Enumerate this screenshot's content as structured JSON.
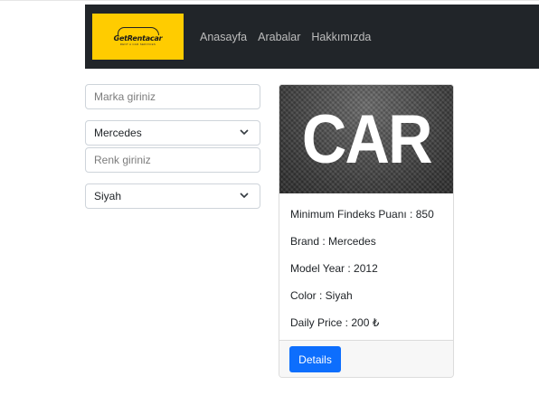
{
  "navbar": {
    "logo": {
      "main_text": "GetRentacar",
      "sub_text": "RENT A CAR SERVICES"
    },
    "links": [
      "Anasayfa",
      "Arabalar",
      "Hakkımızda"
    ]
  },
  "filters": {
    "brand_search": {
      "placeholder": "Marka giriniz",
      "value": ""
    },
    "brand_select": {
      "selected": "Mercedes"
    },
    "color_search": {
      "placeholder": "Renk giriniz",
      "value": ""
    },
    "color_select": {
      "selected": "Siyah"
    }
  },
  "car_card": {
    "image_text": "CAR",
    "details": [
      "Minimum Findeks Puanı : 850",
      "Brand : Mercedes",
      "Model Year : 2012",
      "Color : Siyah",
      "Daily Price : 200 ₺"
    ],
    "details_button": "Details"
  },
  "colors": {
    "navbar_bg": "#212529",
    "logo_bg": "#ffcc00",
    "primary_button": "#0d6efd"
  }
}
